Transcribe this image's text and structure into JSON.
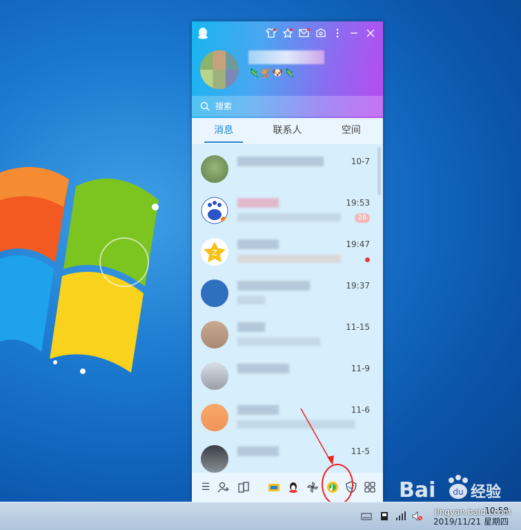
{
  "qq": {
    "search_placeholder": "搜索",
    "tabs": [
      {
        "label": "消息",
        "active": true
      },
      {
        "label": "联系人",
        "active": false
      },
      {
        "label": "空间",
        "active": false
      }
    ],
    "conversations": [
      {
        "time": "10-7",
        "badge": "",
        "unread_dot": false
      },
      {
        "time": "19:53",
        "badge": "28",
        "unread_dot": false
      },
      {
        "time": "19:47",
        "badge": "",
        "unread_dot": true
      },
      {
        "time": "19:37",
        "badge": "",
        "unread_dot": false
      },
      {
        "time": "11-15",
        "badge": "",
        "unread_dot": false
      },
      {
        "time": "11-9",
        "badge": "",
        "unread_dot": false
      },
      {
        "time": "11-6",
        "badge": "",
        "unread_dot": false
      },
      {
        "time": "11-5",
        "badge": "",
        "unread_dot": false
      }
    ],
    "header_icons": [
      "tshirt-icon",
      "star-icon",
      "mail-icon",
      "gift-icon",
      "more-icon",
      "minimize-icon",
      "close-icon"
    ],
    "bottom_icons": [
      "menu-icon",
      "add-contact-icon",
      "apps-icon",
      "game-icon",
      "penguin-icon",
      "pinwheel-icon",
      "music-icon",
      "shield-icon",
      "grid-icon"
    ]
  },
  "taskbar": {
    "time": "10:58",
    "date": "2019/11/21 星期四"
  },
  "watermark": {
    "site": "jingyan.baidu.com",
    "brand": "Bai",
    "brand_du": "du",
    "brand_cn": "经验"
  },
  "colors": {
    "header_start": "#17b6f0",
    "header_end": "#b94af0",
    "accent": "#1a88d8",
    "highlight": "#e22222"
  }
}
